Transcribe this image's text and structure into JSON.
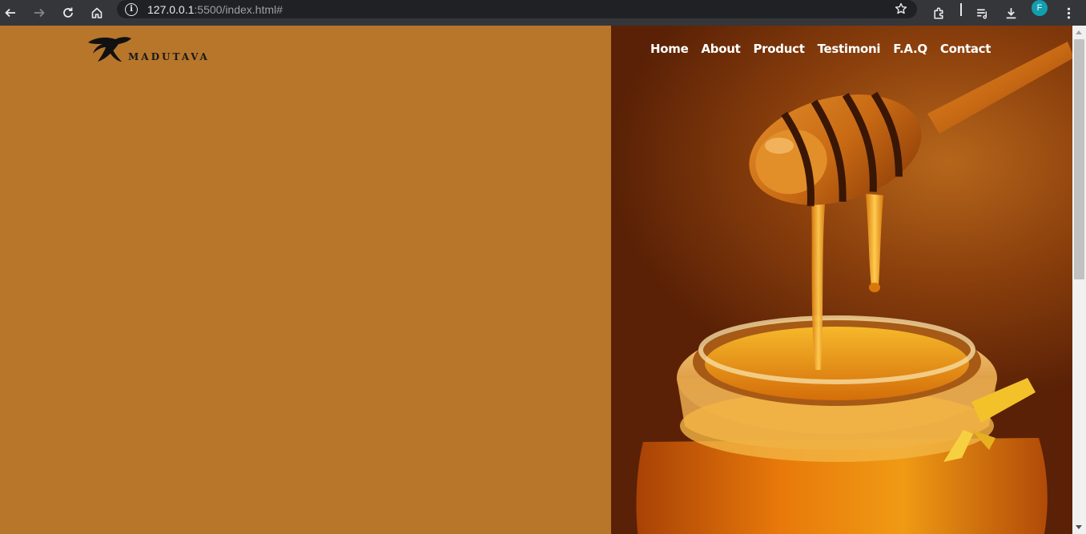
{
  "browser": {
    "url_host": "127.0.0.1",
    "url_rest": ":5500/index.html#",
    "profile_initial": "F",
    "icons": [
      "back-arrow-icon",
      "forward-arrow-icon",
      "reload-icon",
      "home-icon",
      "info-icon",
      "star-icon",
      "extensions-icon",
      "reading-list-icon",
      "download-icon",
      "kebab-menu-icon"
    ]
  },
  "brand": {
    "name": "MADUTAVA",
    "color": "#1a1a1a"
  },
  "nav": {
    "items": [
      "Home",
      "About",
      "Product",
      "Testimoni",
      "F.A.Q",
      "Contact"
    ]
  },
  "colors": {
    "left_panel": "#b8762b",
    "honey_dark": "#5a2106",
    "honey_light": "#f0a020"
  }
}
